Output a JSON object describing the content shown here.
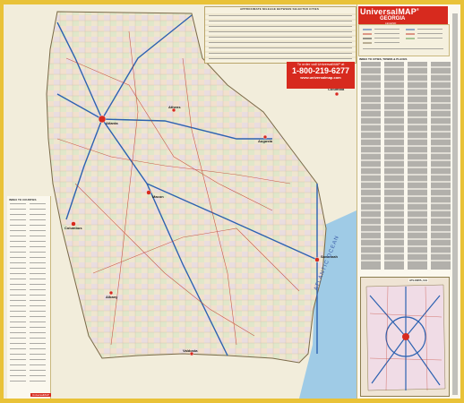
{
  "brand": {
    "name": "UniversalMAP",
    "trademark": "®",
    "state": "GEORGIA",
    "subtitle": "LEGEND"
  },
  "promo": {
    "line1": "To order call UniversalMAP at",
    "phone": "1-800-219-6277",
    "url": "www.universalmap.com"
  },
  "distance_table": {
    "title": "APPROXIMATE MILEAGE BETWEEN SELECTED CITIES"
  },
  "index": {
    "counties_title": "INDEX TO COUNTIES",
    "places_title": "INDEX TO CITIES, TOWNS & PLACES"
  },
  "inset": {
    "title": "ATLANTA, GA"
  },
  "publisher": {
    "label": "UniversalMAP"
  },
  "cities": [
    {
      "name": "Atlanta"
    },
    {
      "name": "Athens"
    },
    {
      "name": "Augusta"
    },
    {
      "name": "Macon"
    },
    {
      "name": "Columbus"
    },
    {
      "name": "Albany"
    },
    {
      "name": "Savannah"
    },
    {
      "name": "Valdosta"
    },
    {
      "name": "Columbia"
    }
  ],
  "ocean": {
    "name": "ATLANTIC OCEAN"
  },
  "colors": {
    "frame": "#e9c238",
    "brand_red": "#d72a1e",
    "ocean_blue": "#9fcbe6",
    "land": "#ede7d3"
  }
}
